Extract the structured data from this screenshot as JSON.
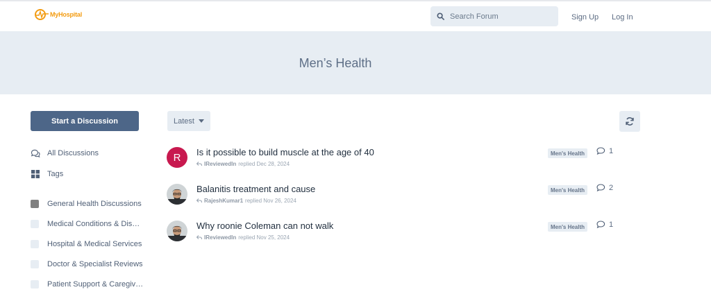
{
  "header": {
    "logo_text": "MyHospital",
    "search_placeholder": "Search Forum",
    "signup_label": "Sign Up",
    "login_label": "Log In"
  },
  "hero": {
    "title": "Men’s Health"
  },
  "sidebar": {
    "start_label": "Start a Discussion",
    "nav": [
      {
        "label": "All Discussions",
        "icon": "comments-icon"
      },
      {
        "label": "Tags",
        "icon": "tags-grid-icon"
      }
    ],
    "tags": [
      {
        "label": "General Health Discussions",
        "color": "#808080"
      },
      {
        "label": "Medical Conditions & Dis…",
        "color": "#e7edf3"
      },
      {
        "label": "Hospital & Medical Services",
        "color": "#e7edf3"
      },
      {
        "label": "Doctor & Specialist Reviews",
        "color": "#e7edf3"
      },
      {
        "label": "Patient Support & Caregiv…",
        "color": "#e7edf3"
      }
    ]
  },
  "toolbar": {
    "sort_label": "Latest",
    "refresh_icon": "refresh-icon"
  },
  "discussions": [
    {
      "avatar_letter": "R",
      "title": "Is it possible to build muscle at the age of 40",
      "user": "IReviewedIn",
      "action": "replied Dec 28, 2024",
      "tag": "Men's Health",
      "replies": "1"
    },
    {
      "avatar_letter": "",
      "title": "Balanitis treatment and cause",
      "user": "RajeshKumar1",
      "action": "replied Nov 26, 2024",
      "tag": "Men's Health",
      "replies": "2"
    },
    {
      "avatar_letter": "",
      "title": "Why roonie Coleman can not walk",
      "user": "IReviewedIn",
      "action": "replied Nov 25, 2024",
      "tag": "Men's Health",
      "replies": "1"
    }
  ],
  "colors": {
    "primary": "#4d6688",
    "hero_bg": "#e7edf3",
    "logo": "#f39c12",
    "avatar_red": "#c8194f"
  }
}
